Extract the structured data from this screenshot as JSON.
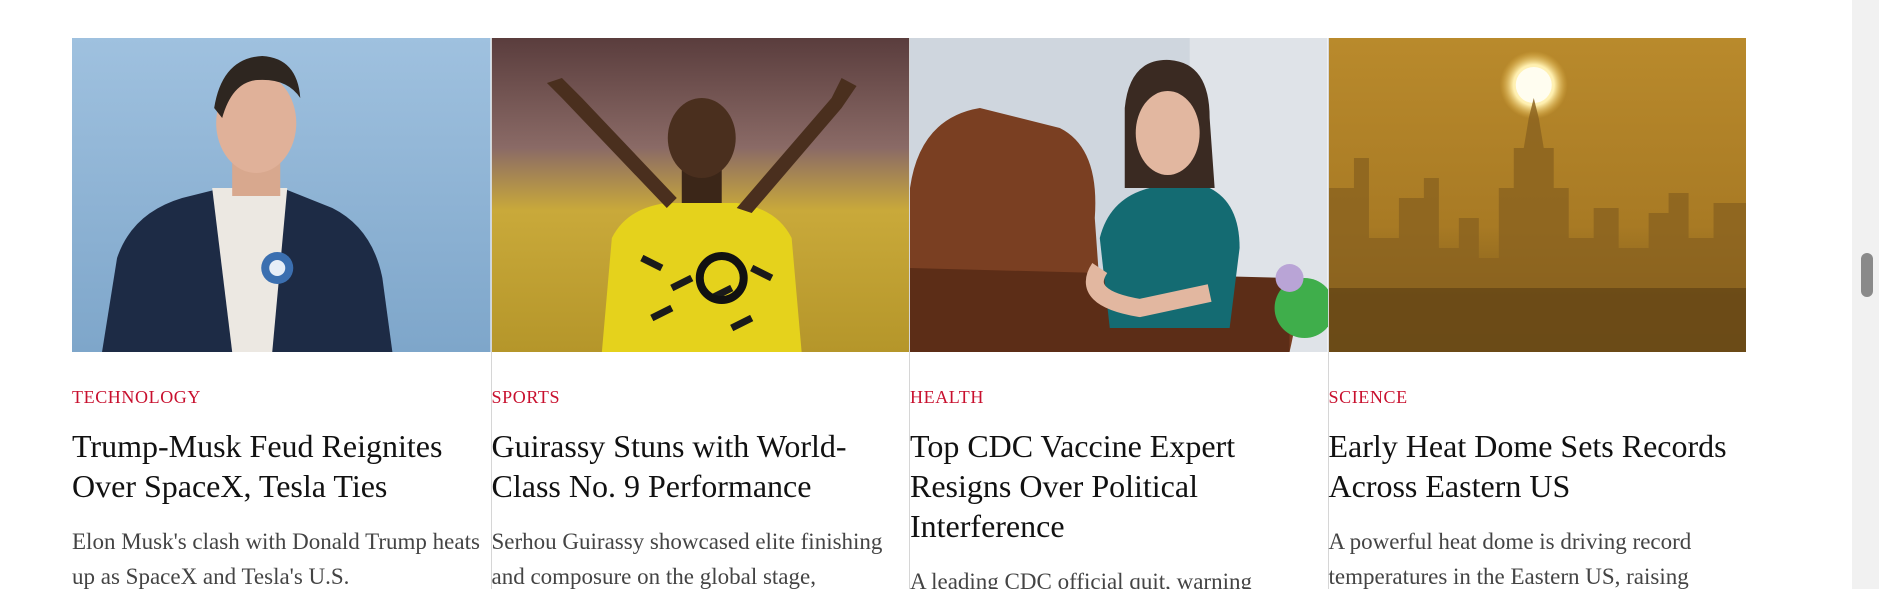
{
  "articles": [
    {
      "category": "TECHNOLOGY",
      "headline": "Trump-Musk Feud Reignites Over SpaceX, Tesla Ties",
      "summary": "Elon Musk's clash with Donald Trump heats up as SpaceX and Tesla's U.S.",
      "image": "man-in-bomber-jacket-photo"
    },
    {
      "category": "SPORTS",
      "headline": "Guirassy Stuns with World-Class No. 9 Performance",
      "summary": "Serhou Guirassy showcased elite finishing and composure on the global stage,",
      "image": "footballer-celebrating-photo"
    },
    {
      "category": "HEALTH",
      "headline": "Top CDC Vaccine Expert Resigns Over Political Interference",
      "summary": "A leading CDC official quit, warning",
      "image": "woman-in-leather-chair-photo"
    },
    {
      "category": "SCIENCE",
      "headline": "Early Heat Dome Sets Records Across Eastern US",
      "summary": "A powerful heat dome is driving record temperatures in the Eastern US, raising",
      "image": "hazy-city-skyline-photo"
    }
  ],
  "colors": {
    "category": "#c8102e",
    "headline": "#111111",
    "summary": "#444444",
    "divider": "#d6d6d6"
  }
}
